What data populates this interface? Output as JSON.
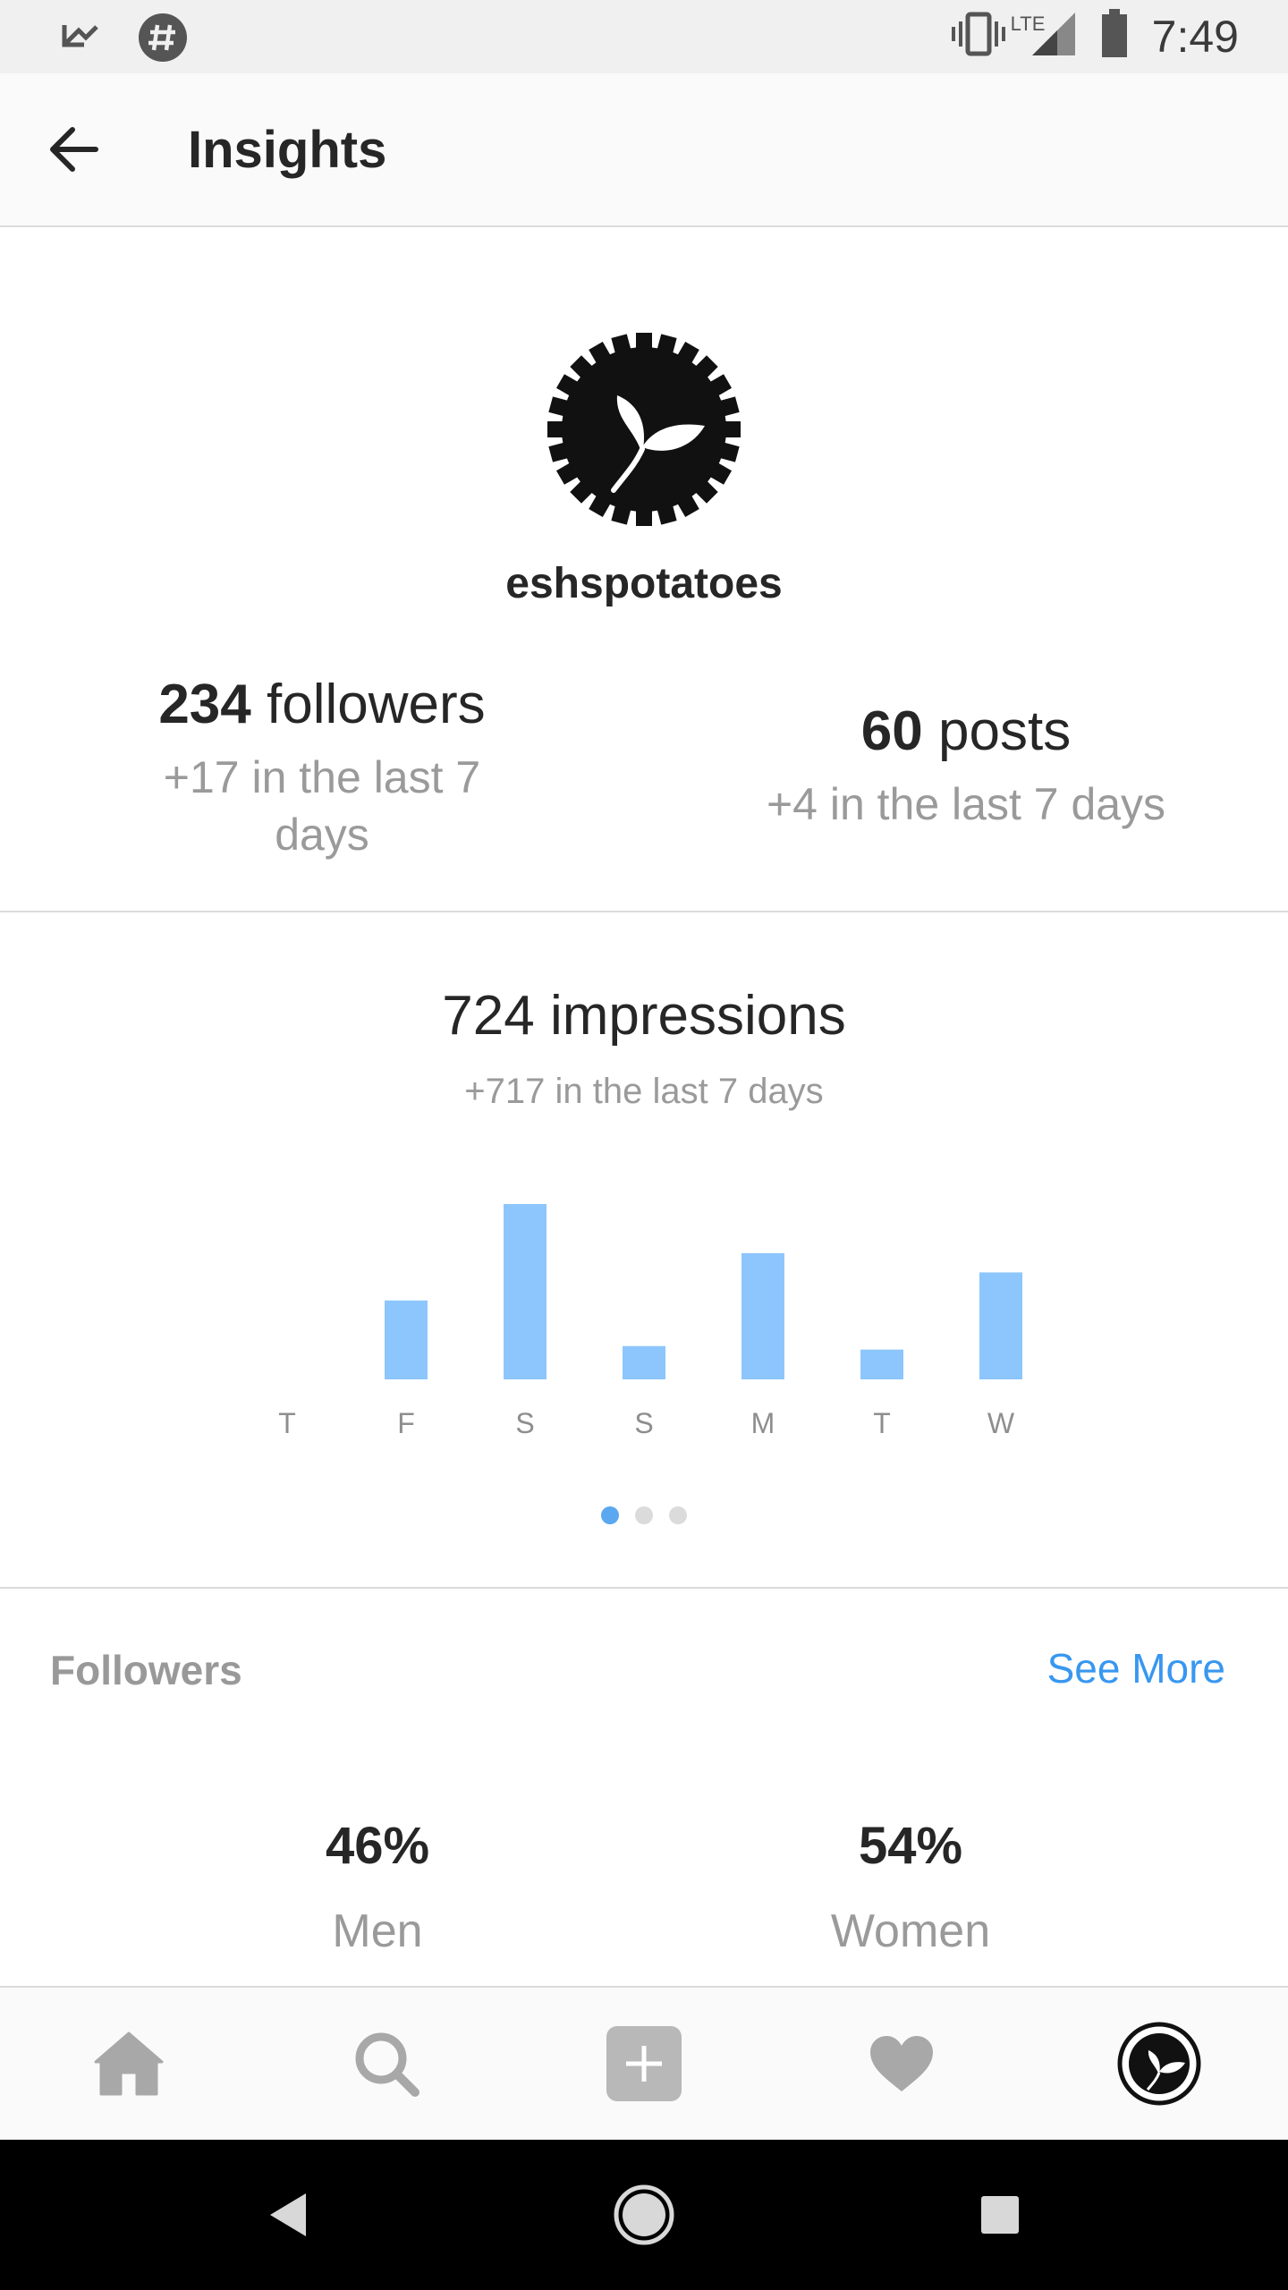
{
  "status_bar": {
    "time": "7:49",
    "network": "LTE",
    "icons": [
      "missed-call-icon",
      "slack-notification-icon",
      "vibrate-icon",
      "signal-icon",
      "battery-icon"
    ]
  },
  "header": {
    "title": "Insights",
    "back_icon": "arrow-back-icon"
  },
  "profile": {
    "username": "eshspotatoes",
    "avatar_icon": "gear-leaf-logo-icon"
  },
  "stats": {
    "followers": {
      "count": "234",
      "label": "followers",
      "delta": "+17 in the last 7 days"
    },
    "posts": {
      "count": "60",
      "label": "posts",
      "delta": "+4 in the last 7 days"
    }
  },
  "impressions": {
    "title": "724 impressions",
    "delta": "+717 in the last 7 days",
    "pager": {
      "pages": 3,
      "active": 0
    }
  },
  "chart_data": {
    "type": "bar",
    "categories": [
      "T",
      "F",
      "S",
      "S",
      "M",
      "T",
      "W"
    ],
    "values": [
      0,
      45,
      100,
      19,
      72,
      17,
      61
    ],
    "title": "",
    "xlabel": "",
    "ylabel": "",
    "ylim": [
      0,
      100
    ],
    "grid": false,
    "colors": {
      "bar": "#8dc6fc",
      "tick_label": "#8e8e8e"
    }
  },
  "followers_section": {
    "title": "Followers",
    "see_more": "See More",
    "men": {
      "percent": "46%",
      "label": "Men"
    },
    "women": {
      "percent": "54%",
      "label": "Women"
    }
  },
  "tab_bar": {
    "tabs": [
      "home-icon",
      "search-icon",
      "add-post-icon",
      "heart-icon",
      "profile-avatar-icon"
    ]
  },
  "nav_bar": {
    "buttons": [
      "back-triangle-icon",
      "home-circle-icon",
      "recents-square-icon"
    ]
  },
  "colors": {
    "accent": "#3897f0",
    "chart_bar": "#8dc6fc",
    "muted_text": "#9a9a9a",
    "divider": "#dbdbdb"
  }
}
